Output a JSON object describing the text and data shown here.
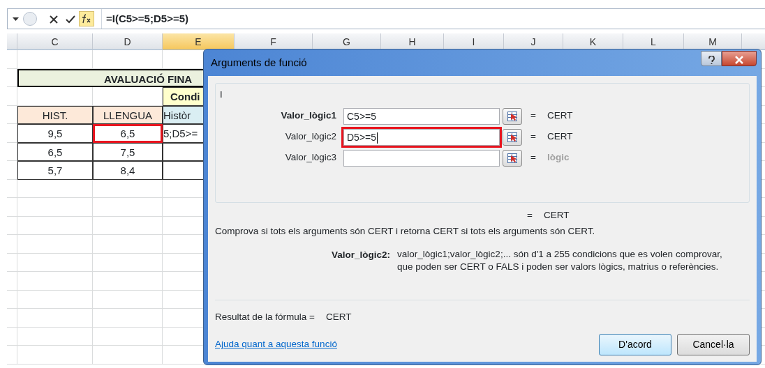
{
  "formula_bar": {
    "formula": "=I(C5>=5;D5>=5)"
  },
  "columns": [
    {
      "label": "C",
      "selected": false
    },
    {
      "label": "D",
      "selected": false
    },
    {
      "label": "E",
      "selected": true
    },
    {
      "label": "F",
      "selected": false
    },
    {
      "label": "G",
      "selected": false
    },
    {
      "label": "H",
      "selected": false
    },
    {
      "label": "I",
      "selected": false
    },
    {
      "label": "J",
      "selected": false
    },
    {
      "label": "K",
      "selected": false
    },
    {
      "label": "L",
      "selected": false
    },
    {
      "label": "M",
      "selected": false
    }
  ],
  "sheet_rows": [
    {
      "kind": "empty"
    },
    {
      "kind": "title",
      "text": "AVALUACIÓ FINA"
    },
    {
      "kind": "group",
      "text": "Condi"
    },
    {
      "kind": "data",
      "cells": [
        {
          "text": "HIST.",
          "color": "#fde9d9",
          "highlighted": false
        },
        {
          "text": "LLENGUA",
          "color": "#fde9d9",
          "highlighted": false
        },
        {
          "text": "Històr",
          "color": "#daeef3",
          "highlighted": false
        }
      ]
    },
    {
      "kind": "data",
      "cells": [
        {
          "text": "9,5",
          "highlighted": false
        },
        {
          "text": "6,5",
          "highlighted": true
        },
        {
          "text": "5;D5>=",
          "highlighted": false
        }
      ]
    },
    {
      "kind": "data",
      "cells": [
        {
          "text": "6,5",
          "highlighted": false
        },
        {
          "text": "7,5",
          "highlighted": false
        },
        {
          "highlighted": false
        }
      ]
    },
    {
      "kind": "data",
      "cells": [
        {
          "text": "5,7",
          "highlighted": false
        },
        {
          "text": "8,4",
          "highlighted": false
        },
        {
          "highlighted": false
        }
      ]
    }
  ],
  "dialog": {
    "title": "Arguments de funció",
    "function_name": "I",
    "arguments": [
      {
        "label": "Valor_lògic1",
        "value": "C5>=5",
        "result": "CERT",
        "bold": true,
        "highlighted": false,
        "greyed": false
      },
      {
        "label": "Valor_lògic2",
        "value": "D5>=5",
        "result": "CERT",
        "bold": false,
        "highlighted": true,
        "greyed": false
      },
      {
        "label": "Valor_lògic3",
        "result": "lògic",
        "bold": false,
        "highlighted": false,
        "greyed": true
      }
    ],
    "equals": "=",
    "total_result": "CERT",
    "description": "Comprova si tots els arguments són CERT i retorna CERT si tots els arguments són CERT.",
    "argument_help_label": "Valor_lògic2:",
    "argument_help": [
      "valor_lògic1;valor_lògic2;... són d'1 a 255 condicions que es volen comprovar,",
      "que poden ser CERT o FALS i poden ser valors lògics, matrius o referències."
    ],
    "formula_result_label": "Resultat de la fórmula =",
    "formula_result": "CERT",
    "help_link": "Ajuda quant a aquesta funció",
    "buttons": [
      {
        "label": "D'acord",
        "default": true
      },
      {
        "label": "Cancel·la",
        "default": false
      }
    ]
  }
}
